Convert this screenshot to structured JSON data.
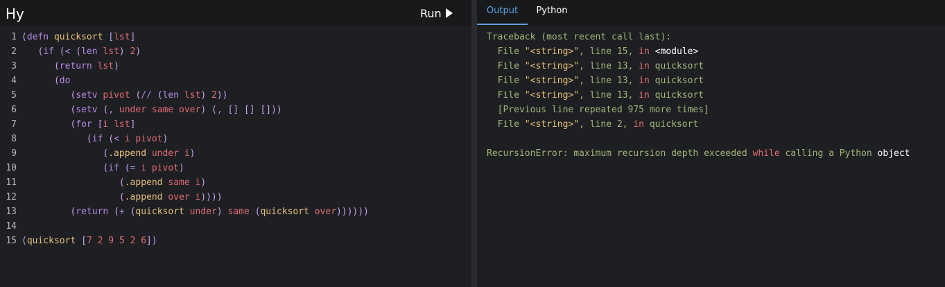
{
  "app": {
    "title": "Hy",
    "run_label": "Run"
  },
  "tabs": {
    "output": "Output",
    "python": "Python"
  },
  "editor": {
    "line_numbers": [
      "1",
      "2",
      "3",
      "4",
      "5",
      "6",
      "7",
      "8",
      "9",
      "10",
      "11",
      "12",
      "13",
      "14",
      "15"
    ],
    "lines": [
      "(defn quicksort [lst]",
      "   (if (< (len lst) 2)",
      "      (return lst)",
      "      (do",
      "         (setv pivot (// (len lst) 2))",
      "         (setv (, under same over) (, [] [] []))",
      "         (for [i lst]",
      "            (if (< i pivot)",
      "               (.append under i)",
      "               (if (= i pivot)",
      "                  (.append same i)",
      "                  (.append over i))))",
      "         (return (+ (quicksort under) same (quicksort over))))))",
      "",
      "(quicksort [7 2 9 5 2 6])"
    ]
  },
  "output": {
    "lines": [
      "Traceback (most recent call last):",
      "  File \"<string>\", line 15, in <module>",
      "  File \"<string>\", line 13, in quicksort",
      "  File \"<string>\", line 13, in quicksort",
      "  File \"<string>\", line 13, in quicksort",
      "  [Previous line repeated 975 more times]",
      "  File \"<string>\", line 2, in quicksort",
      "",
      "RecursionError: maximum recursion depth exceeded while calling a Python object"
    ]
  }
}
